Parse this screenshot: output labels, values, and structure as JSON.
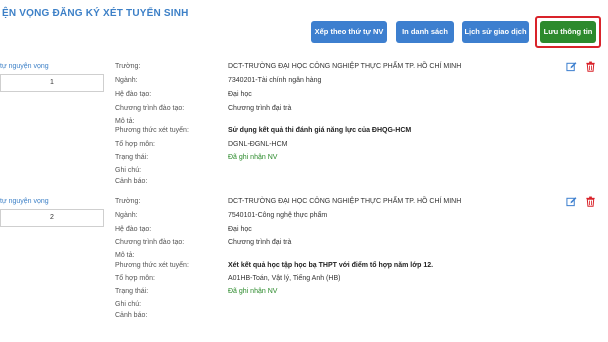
{
  "page": {
    "title": "ỆN VỌNG ĐĂNG KÝ XÉT TUYỂN SINH"
  },
  "toolbar": {
    "sort_button": "Xếp theo thứ tự NV",
    "print_button": "In danh sách",
    "history_button": "Lịch sử giao dịch",
    "save_button": "Lưu thông tin"
  },
  "labels": {
    "truong": "Trường:",
    "nganh": "Ngành:",
    "he_dao_tao": "Hệ đào tạo:",
    "chuong_trinh": "Chương trình đào tạo:",
    "mo_ta": "Mô tả:",
    "phuong_thuc": "Phương thức xét tuyển:",
    "to_hop": "Tổ hợp môn:",
    "trang_thai": "Trạng thái:",
    "ghi_chu": "Ghi chú:",
    "canh_bao": "Cảnh báo:"
  },
  "wishes": [
    {
      "order_label": "tự nguyện vọng",
      "order": "1",
      "truong": "DCT-TRƯỜNG ĐẠI HỌC CÔNG NGHIỆP THỰC PHẨM TP. HỒ CHÍ MINH",
      "nganh": "7340201-Tài chính ngân hàng",
      "he_dao_tao": "Đại học",
      "chuong_trinh": "Chương trình đại trà",
      "mo_ta": "",
      "phuong_thuc": "Sử dụng kết quả thi đánh giá năng lực của ĐHQG-HCM",
      "to_hop": "DGNL-ĐGNL-HCM",
      "trang_thai": "Đã ghi nhận NV",
      "ghi_chu": "",
      "canh_bao": ""
    },
    {
      "order_label": "tự nguyện vọng",
      "order": "2",
      "truong": "DCT-TRƯỜNG ĐẠI HỌC CÔNG NGHIỆP THỰC PHẨM TP. HỒ CHÍ MINH",
      "nganh": "7540101-Công nghệ thực phẩm",
      "he_dao_tao": "Đại học",
      "chuong_trinh": "Chương trình đại trà",
      "mo_ta": "",
      "phuong_thuc": "Xét kết quả học tập học bạ THPT với điểm tổ hợp năm lớp 12.",
      "to_hop": "A01HB-Toán, Vật lý, Tiếng Anh (HB)",
      "trang_thai": "Đã ghi nhận NV",
      "ghi_chu": "",
      "canh_bao": ""
    }
  ],
  "colors": {
    "title": "#3d80c7",
    "button_blue": "#3d7fcf",
    "button_green": "#2d8a2d",
    "highlight": "#d9232a",
    "status_green": "#2a8a2a",
    "edit_icon": "#3d7fcf",
    "delete_icon": "#d9232a"
  },
  "icons": {
    "edit": "edit-icon",
    "delete": "trash-icon"
  }
}
